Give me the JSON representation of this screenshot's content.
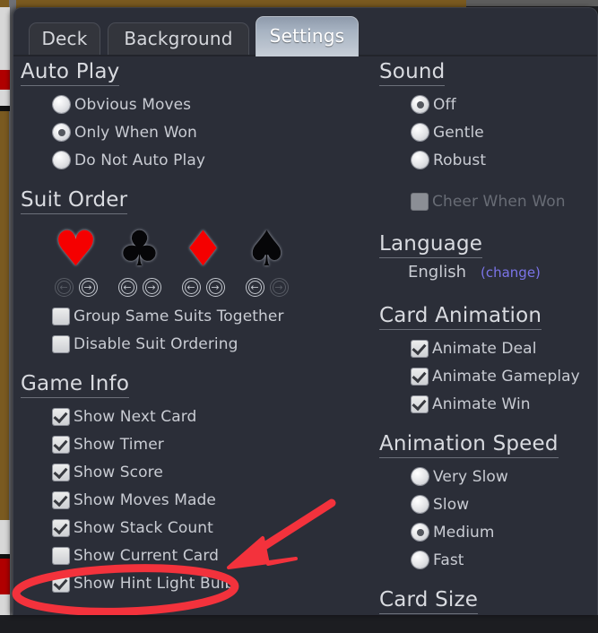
{
  "window": {
    "title": "Settings"
  },
  "tabs": [
    {
      "label": "Deck",
      "active": false
    },
    {
      "label": "Background",
      "active": false
    },
    {
      "label": "Settings",
      "active": true
    }
  ],
  "left_column": {
    "auto_play": {
      "title": "Auto Play",
      "options": [
        {
          "label": "Obvious Moves",
          "selected": false
        },
        {
          "label": "Only When Won",
          "selected": true
        },
        {
          "label": "Do Not Auto Play",
          "selected": false
        }
      ]
    },
    "suit_order": {
      "title": "Suit Order",
      "suits": [
        {
          "name": "heart-suit",
          "glyph": "♥",
          "color": "red",
          "left_enabled": false,
          "right_enabled": true
        },
        {
          "name": "club-suit",
          "glyph": "♣",
          "color": "black",
          "left_enabled": true,
          "right_enabled": true
        },
        {
          "name": "diamond-suit",
          "glyph": "♦",
          "color": "red",
          "left_enabled": true,
          "right_enabled": true
        },
        {
          "name": "spade-suit",
          "glyph": "♠",
          "color": "black",
          "left_enabled": true,
          "right_enabled": false
        }
      ],
      "arrow_left": "←",
      "arrow_right": "→",
      "checkboxes": [
        {
          "label": "Group Same Suits Together",
          "checked": false
        },
        {
          "label": "Disable Suit Ordering",
          "checked": false
        }
      ]
    },
    "game_info": {
      "title": "Game Info",
      "checkboxes": [
        {
          "label": "Show Next Card",
          "checked": true
        },
        {
          "label": "Show Timer",
          "checked": true
        },
        {
          "label": "Show Score",
          "checked": true
        },
        {
          "label": "Show Moves Made",
          "checked": true
        },
        {
          "label": "Show Stack Count",
          "checked": true
        },
        {
          "label": "Show Current Card",
          "checked": false
        },
        {
          "label": "Show Hint Light Bulb",
          "checked": true
        }
      ]
    }
  },
  "right_column": {
    "sound": {
      "title": "Sound",
      "options": [
        {
          "label": "Off",
          "selected": true
        },
        {
          "label": "Gentle",
          "selected": false
        },
        {
          "label": "Robust",
          "selected": false
        }
      ],
      "cheer": {
        "label": "Cheer When Won",
        "checked": false,
        "disabled": true
      }
    },
    "language": {
      "title": "Language",
      "value": "English",
      "change_label": "(change)"
    },
    "card_animation": {
      "title": "Card Animation",
      "checkboxes": [
        {
          "label": "Animate Deal",
          "checked": true
        },
        {
          "label": "Animate Gameplay",
          "checked": true
        },
        {
          "label": "Animate Win",
          "checked": true
        }
      ]
    },
    "animation_speed": {
      "title": "Animation Speed",
      "options": [
        {
          "label": "Very Slow",
          "selected": false
        },
        {
          "label": "Slow",
          "selected": false
        },
        {
          "label": "Medium",
          "selected": true
        },
        {
          "label": "Fast",
          "selected": false
        }
      ]
    },
    "card_size": {
      "title": "Card Size"
    }
  },
  "annotation": {
    "color": "#f3323c",
    "description": "red arrow pointing to a red ellipse circling Show Hint Light Bulb"
  },
  "colors": {
    "panel_bg": "#2b2e38",
    "text": "#c9ccd3",
    "link": "#7b74e8",
    "suit_red": "#f50000",
    "suit_black": "#060608",
    "annotation_red": "#f3323c"
  }
}
